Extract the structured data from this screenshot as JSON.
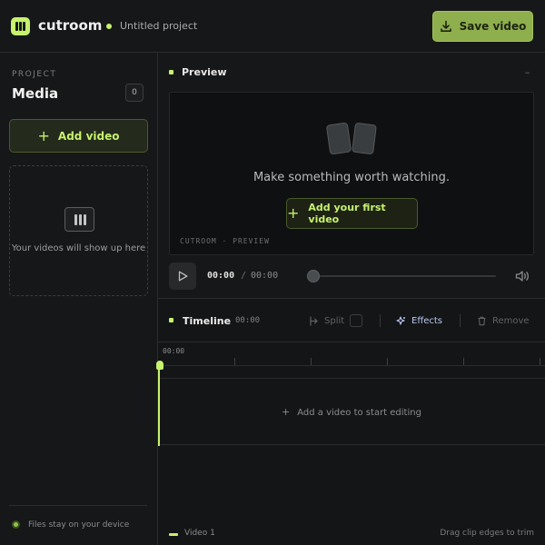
{
  "header": {
    "brand": "cutroom",
    "project_name": "Untitled project",
    "save_label": "Save video",
    "accent_color": "#c6f26e"
  },
  "sidebar": {
    "eyebrow": "PROJECT",
    "title": "Media",
    "count": "0",
    "add_video_label": "Add video",
    "empty_text": "Your videos will show up here",
    "footer_text": "Files stay on your device"
  },
  "preview": {
    "title": "Preview",
    "collapse_glyph": "–",
    "heading": "Make something worth watching.",
    "add_first_label": "Add your first video",
    "caption": "CUTROOM · PREVIEW",
    "current_time": "00:00",
    "separator": "/",
    "total_time": "00:00",
    "seek_progress": 0
  },
  "timeline": {
    "title": "Timeline",
    "time": "00:00",
    "tools": {
      "split_label": "Split",
      "effects_label": "Effects",
      "remove_label": "Remove"
    },
    "ruler_start": "00:00",
    "empty_text": "Add a video to start editing",
    "track_name": "Video 1",
    "hint": "Drag clip edges to trim"
  }
}
